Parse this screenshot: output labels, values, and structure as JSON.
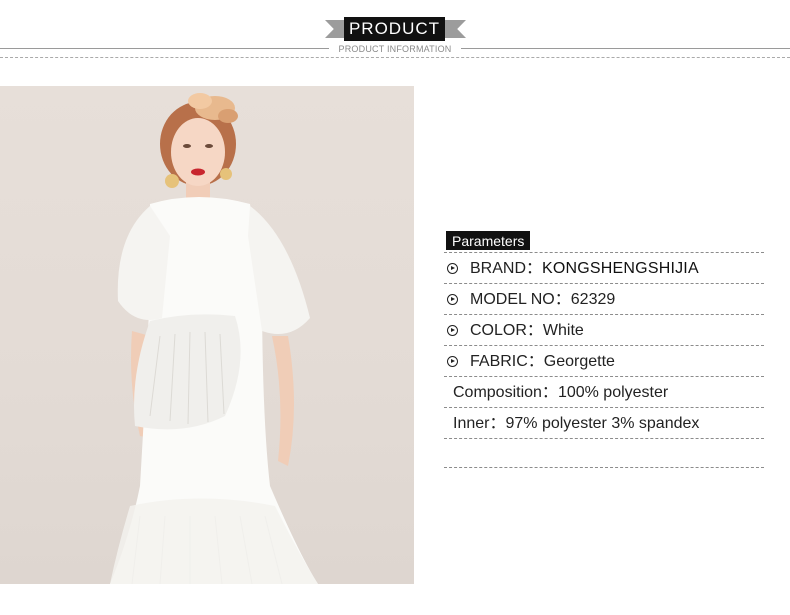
{
  "header": {
    "title": "PRODUCT",
    "subtitle": "PRODUCT INFORMATION"
  },
  "image": {
    "subject": "model-in-white-ruffled-dress",
    "background_color": "#e5ddd7"
  },
  "parameters": {
    "title": "Parameters",
    "rows": [
      {
        "label": "BRAND：",
        "value": "KONGSHENGSHIJIA",
        "icon": "circle-arrow-icon"
      },
      {
        "label": "MODEL NO：",
        "value": "62329",
        "icon": "circle-arrow-icon"
      },
      {
        "label": "COLOR：",
        "value": "White",
        "icon": "circle-arrow-icon"
      },
      {
        "label": "FABRIC：",
        "value": "Georgette",
        "icon": "circle-arrow-icon"
      },
      {
        "label": "Composition：",
        "value": "100% polyester"
      },
      {
        "label": "Inner：",
        "value": "97% polyester 3% spandex"
      }
    ]
  },
  "colors": {
    "accent": "#111111",
    "rule": "#8c8c8c"
  }
}
